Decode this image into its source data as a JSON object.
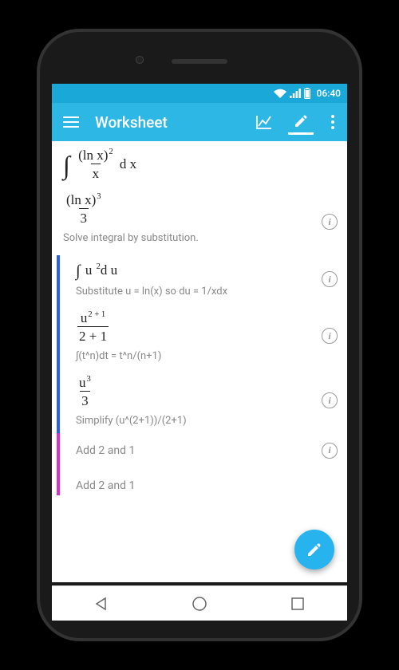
{
  "statusbar": {
    "time": "06:40"
  },
  "appbar": {
    "title": "Worksheet"
  },
  "rows": {
    "r0": {
      "expr_lnx": "(ln x)",
      "expr_sup2": "2",
      "expr_den": "x",
      "expr_dx": "d x"
    },
    "r1": {
      "expr_lnx": "(ln x)",
      "expr_sup3": "3",
      "expr_den": "3",
      "note": "Solve integral by substitution."
    },
    "r2": {
      "expr": "∫ u ²d u",
      "sub": "Substitute u = ln(x) so du = 1/xdx"
    },
    "r3": {
      "num_base": "u",
      "num_sup": "2 + 1",
      "den": "2 + 1",
      "note": "∫(t^n)dt = t^n/(n+1)"
    },
    "r4": {
      "num_base": "u",
      "num_sup": "3",
      "den": "3",
      "note": "Simplify (u^(2+1))/(2+1)"
    },
    "r5": {
      "label": "Add 2 and 1"
    },
    "r6": {
      "label": "Add 2 and 1"
    }
  }
}
